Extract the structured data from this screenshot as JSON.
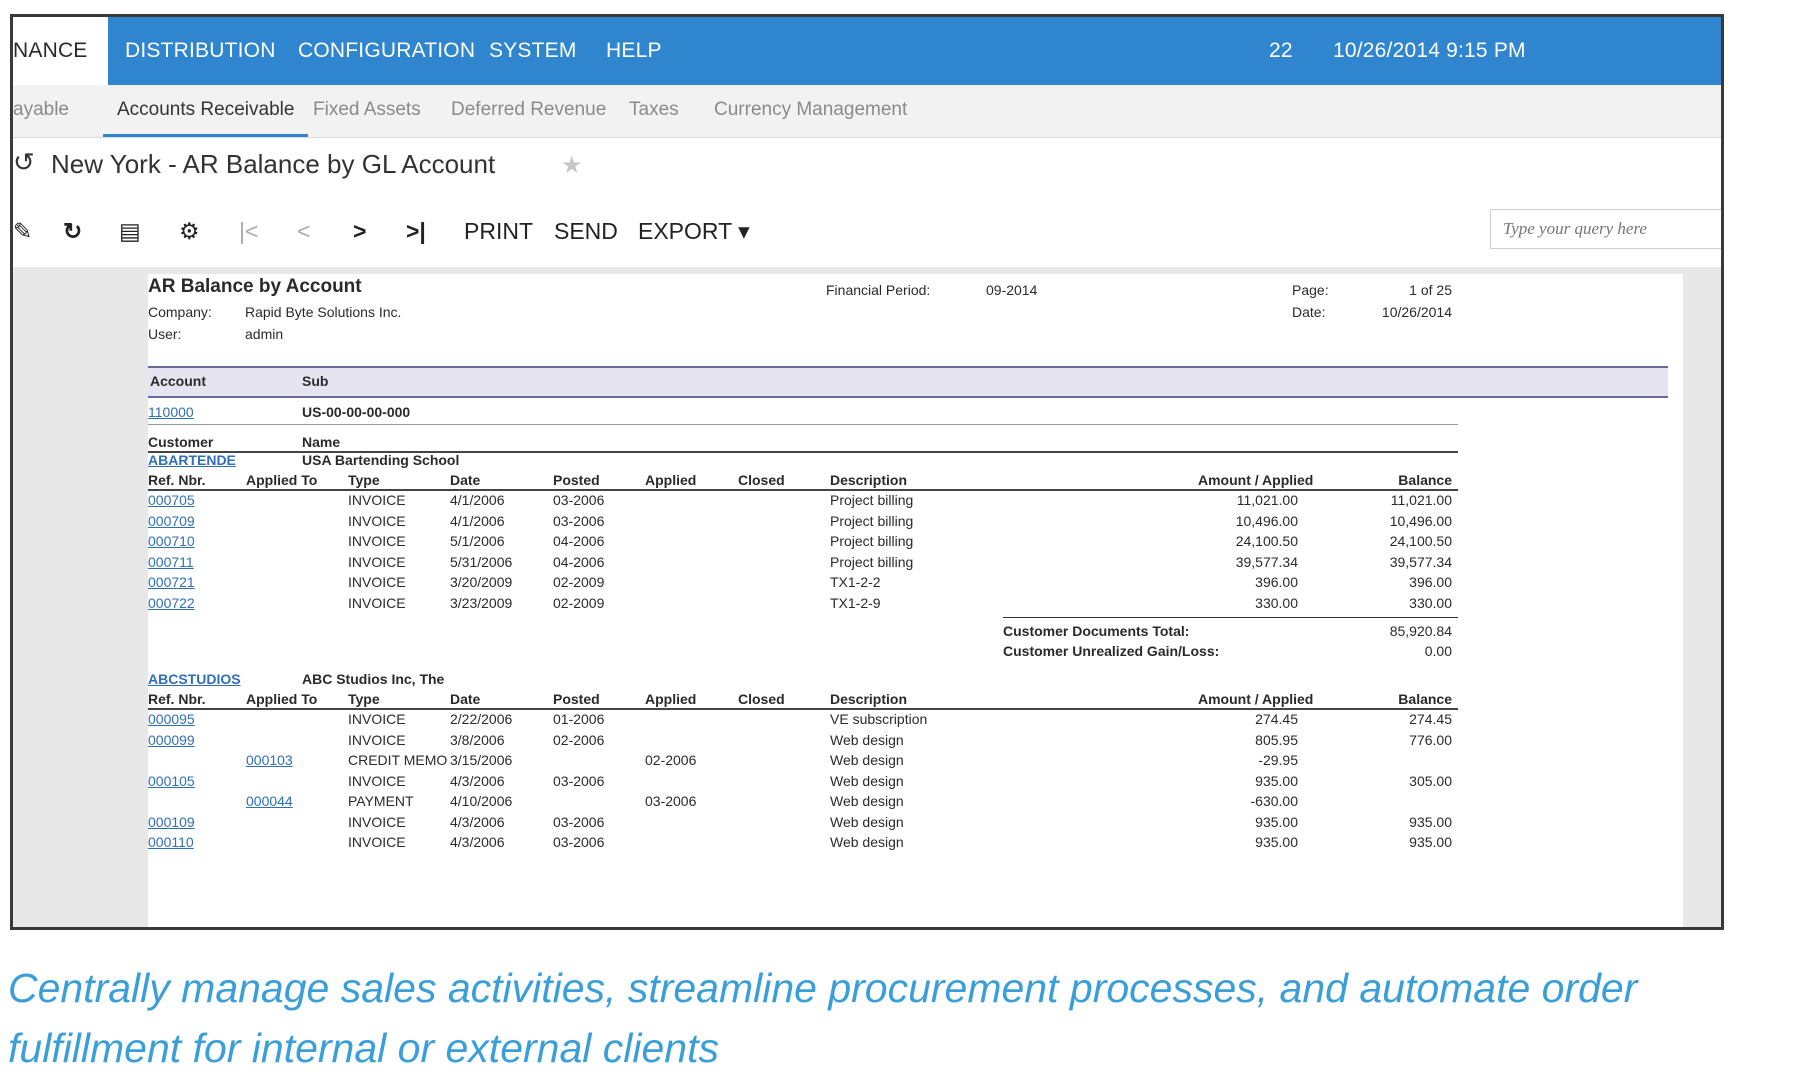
{
  "topnav": {
    "items": [
      "NANCE",
      "DISTRIBUTION",
      "CONFIGURATION",
      "SYSTEM",
      "HELP"
    ],
    "count": "22",
    "datetime": "10/26/2014  9:15 PM"
  },
  "subnav": {
    "items": [
      "ayable",
      "Accounts Receivable",
      "Fixed Assets",
      "Deferred Revenue",
      "Taxes",
      "Currency Management"
    ]
  },
  "titlebar": {
    "title": "New York  -  AR Balance by GL Account"
  },
  "toolbar": {
    "print": "PRINT",
    "send": "SEND",
    "export": "EXPORT ▾",
    "search_placeholder": "Type your query here"
  },
  "report": {
    "title": "AR Balance by Account",
    "company_label": "Company:",
    "company": "Rapid Byte Solutions Inc.",
    "user_label": "User:",
    "user": "admin",
    "period_label": "Financial Period:",
    "period": "09-2014",
    "page_label": "Page:",
    "page": "1 of 25",
    "date_label": "Date:",
    "date": "10/26/2014",
    "header": {
      "account": "Account",
      "sub": "Sub"
    },
    "account": "110000",
    "sub": "US-00-00-00-000",
    "customer_label": "Customer",
    "name_label": "Name",
    "columns": [
      "Ref. Nbr.",
      "Applied To",
      "Type",
      "Date",
      "Posted",
      "Applied",
      "Closed",
      "Description",
      "Amount / Applied",
      "Balance"
    ],
    "customers": [
      {
        "id": "ABARTENDE",
        "name": "USA Bartending School",
        "rows": [
          {
            "ref": "000705",
            "applied_to": "",
            "type": "INVOICE",
            "date": "4/1/2006",
            "posted": "03-2006",
            "applied": "",
            "closed": "",
            "desc": "Project billing",
            "amount": "11,021.00",
            "balance": "11,021.00"
          },
          {
            "ref": "000709",
            "applied_to": "",
            "type": "INVOICE",
            "date": "4/1/2006",
            "posted": "03-2006",
            "applied": "",
            "closed": "",
            "desc": "Project billing",
            "amount": "10,496.00",
            "balance": "10,496.00"
          },
          {
            "ref": "000710",
            "applied_to": "",
            "type": "INVOICE",
            "date": "5/1/2006",
            "posted": "04-2006",
            "applied": "",
            "closed": "",
            "desc": "Project billing",
            "amount": "24,100.50",
            "balance": "24,100.50"
          },
          {
            "ref": "000711",
            "applied_to": "",
            "type": "INVOICE",
            "date": "5/31/2006",
            "posted": "04-2006",
            "applied": "",
            "closed": "",
            "desc": "Project billing",
            "amount": "39,577.34",
            "balance": "39,577.34"
          },
          {
            "ref": "000721",
            "applied_to": "",
            "type": "INVOICE",
            "date": "3/20/2009",
            "posted": "02-2009",
            "applied": "",
            "closed": "",
            "desc": "TX1-2-2",
            "amount": "396.00",
            "balance": "396.00"
          },
          {
            "ref": "000722",
            "applied_to": "",
            "type": "INVOICE",
            "date": "3/23/2009",
            "posted": "02-2009",
            "applied": "",
            "closed": "",
            "desc": "TX1-2-9",
            "amount": "330.00",
            "balance": "330.00"
          }
        ],
        "docs_total_label": "Customer Documents Total:",
        "docs_total": "85,920.84",
        "gain_loss_label": "Customer Unrealized Gain/Loss:",
        "gain_loss": "0.00"
      },
      {
        "id": "ABCSTUDIOS",
        "name": "ABC Studios Inc, The",
        "rows": [
          {
            "ref": "000095",
            "applied_to": "",
            "type": "INVOICE",
            "date": "2/22/2006",
            "posted": "01-2006",
            "applied": "",
            "closed": "",
            "desc": "VE subscription",
            "amount": "274.45",
            "balance": "274.45"
          },
          {
            "ref": "000099",
            "applied_to": "",
            "type": "INVOICE",
            "date": "3/8/2006",
            "posted": "02-2006",
            "applied": "",
            "closed": "",
            "desc": "Web design",
            "amount": "805.95",
            "balance": "776.00"
          },
          {
            "ref": "",
            "applied_to": "000103",
            "type": "CREDIT MEMO",
            "date": "3/15/2006",
            "posted": "",
            "applied": "02-2006",
            "closed": "",
            "desc": "Web design",
            "amount": "-29.95",
            "balance": ""
          },
          {
            "ref": "000105",
            "applied_to": "",
            "type": "INVOICE",
            "date": "4/3/2006",
            "posted": "03-2006",
            "applied": "",
            "closed": "",
            "desc": "Web design",
            "amount": "935.00",
            "balance": "305.00"
          },
          {
            "ref": "",
            "applied_to": "000044",
            "type": "PAYMENT",
            "date": "4/10/2006",
            "posted": "",
            "applied": "03-2006",
            "closed": "",
            "desc": "Web design",
            "amount": "-630.00",
            "balance": ""
          },
          {
            "ref": "000109",
            "applied_to": "",
            "type": "INVOICE",
            "date": "4/3/2006",
            "posted": "03-2006",
            "applied": "",
            "closed": "",
            "desc": "Web design",
            "amount": "935.00",
            "balance": "935.00"
          },
          {
            "ref": "000110",
            "applied_to": "",
            "type": "INVOICE",
            "date": "4/3/2006",
            "posted": "03-2006",
            "applied": "",
            "closed": "",
            "desc": "Web design",
            "amount": "935.00",
            "balance": "935.00"
          }
        ]
      }
    ]
  },
  "caption": "Centrally manage sales activities, streamline procurement processes, and automate order fulfillment for internal or external clients"
}
